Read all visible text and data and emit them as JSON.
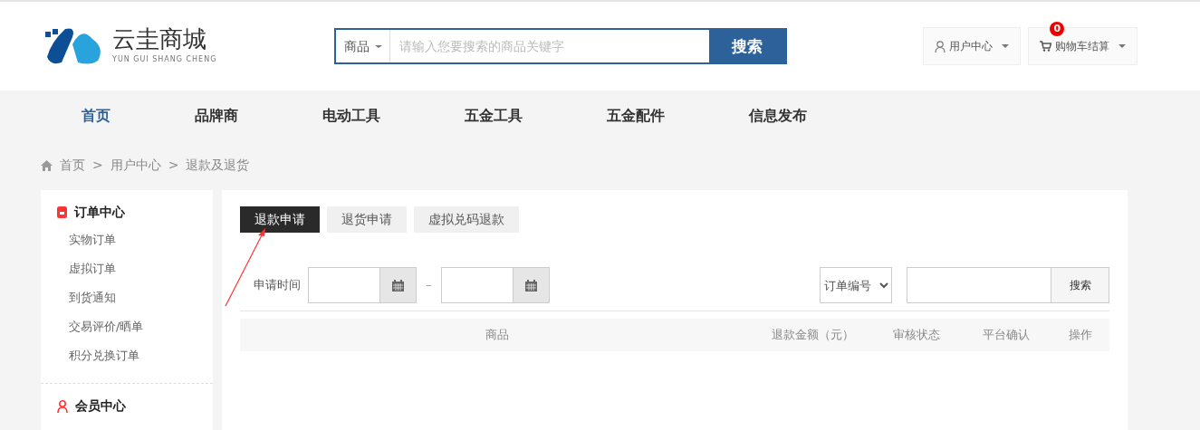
{
  "logo": {
    "name": "云圭商城",
    "subtitle": "YUN GUI SHANG CHENG"
  },
  "search": {
    "scope": "商品",
    "placeholder": "请输入您要搜索的商品关键字",
    "button": "搜索"
  },
  "header_buttons": [
    {
      "kind": "user",
      "label": "用户中心"
    },
    {
      "kind": "cart",
      "label": "购物车结算",
      "badge": "0"
    }
  ],
  "nav": [
    {
      "label": "首页",
      "selected": true
    },
    {
      "label": "品牌商",
      "selected": false
    },
    {
      "label": "电动工具",
      "selected": false
    },
    {
      "label": "五金工具",
      "selected": false
    },
    {
      "label": "五金配件",
      "selected": false
    },
    {
      "label": "信息发布",
      "selected": false
    }
  ],
  "breadcrumb": {
    "separator": ">",
    "items": [
      "首页",
      "用户中心",
      "退款及退货"
    ]
  },
  "sidebar": [
    {
      "kind": "order",
      "title": "订单中心",
      "items": [
        "实物订单",
        "虚拟订单",
        "到货通知",
        "交易评价/晒单",
        "积分兑换订单"
      ]
    },
    {
      "kind": "member",
      "title": "会员中心"
    }
  ],
  "tabs": [
    {
      "label": "退款申请",
      "selected": true
    },
    {
      "label": "退货申请",
      "selected": false
    },
    {
      "label": "虚拟兑码退款",
      "selected": false
    }
  ],
  "filter": {
    "date_label": "申请时间",
    "separator": "–",
    "select": "订单编号",
    "button": "搜索"
  },
  "table": {
    "columns": [
      "商品",
      "退款金额（元）",
      "审核状态",
      "平台确认",
      "操作"
    ]
  }
}
